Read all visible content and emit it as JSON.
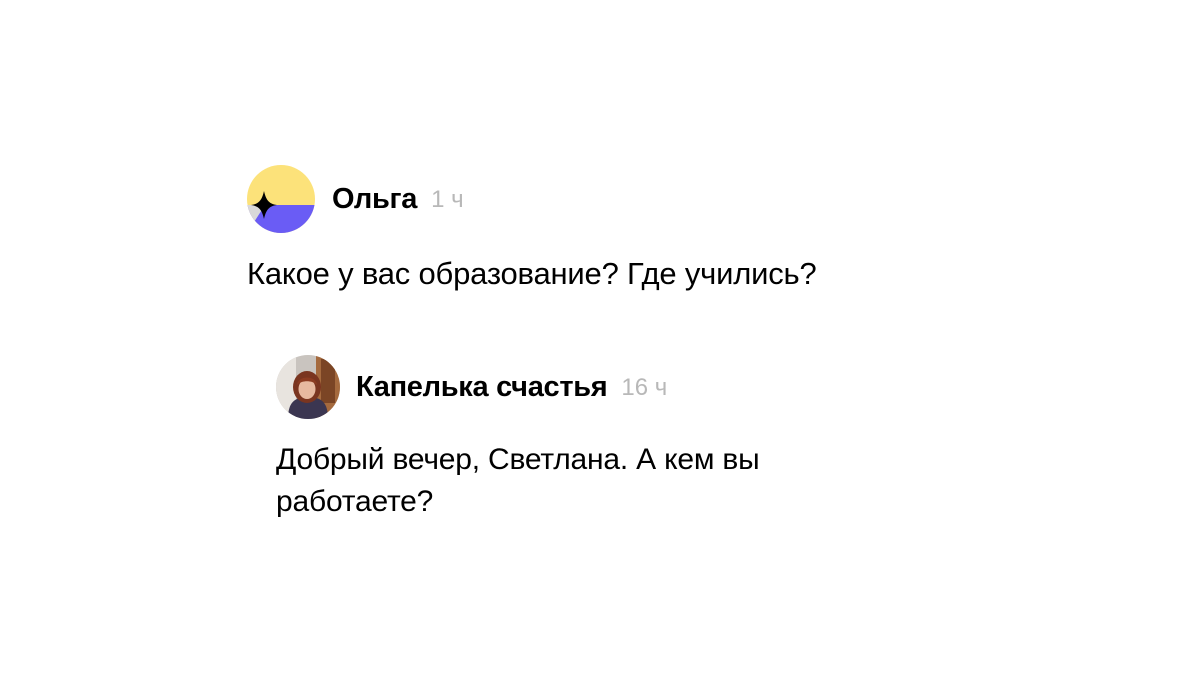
{
  "comments": [
    {
      "author": "Ольга",
      "time": "1 ч",
      "text": "Какое у вас образование? Где учились?",
      "avatar": "yellow-purple-logo-avatar"
    },
    {
      "author": "Капелька счастья",
      "time": "16 ч",
      "text": "Добрый вечер, Светлана. А кем вы работаете?",
      "avatar": "user-photo-avatar"
    }
  ],
  "colors": {
    "avatar_yellow": "#fce27a",
    "avatar_purple": "#6a5cf5",
    "avatar_gray": "#d9d9d9",
    "time_gray": "#b8b8b8",
    "text": "#000000"
  }
}
